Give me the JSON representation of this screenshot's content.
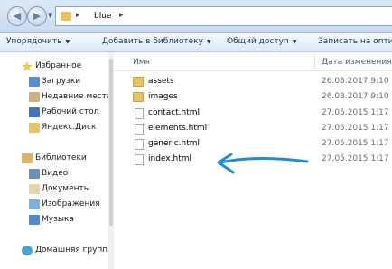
{
  "address": {
    "crumb": "blue",
    "sep": "▸"
  },
  "toolbar": {
    "organize": "Упорядочить",
    "add_library": "Добавить в библиотеку",
    "share": "Общий доступ",
    "burn": "Записать на оптич",
    "dropdown": "▼"
  },
  "nav": {
    "favorites": "Избранное",
    "downloads": "Загрузки",
    "recent": "Недавние места",
    "desktop": "Рабочий стол",
    "yadisk": "Яндекс.Диск",
    "libraries": "Библиотеки",
    "video": "Видео",
    "documents": "Документы",
    "images": "Изображения",
    "music": "Музыка",
    "homegroup": "Домашняя группа"
  },
  "columns": {
    "name": "Имя",
    "date": "Дата изменения"
  },
  "files": [
    {
      "name": "assets",
      "date": "26.03.2017 9:10",
      "kind": "folder"
    },
    {
      "name": "images",
      "date": "26.03.2017 9:10",
      "kind": "folder"
    },
    {
      "name": "contact.html",
      "date": "27.05.2015 1:17",
      "kind": "html"
    },
    {
      "name": "elements.html",
      "date": "27.05.2015 1:17",
      "kind": "html"
    },
    {
      "name": "generic.html",
      "date": "27.05.2015 1:17",
      "kind": "html"
    },
    {
      "name": "index.html",
      "date": "27.05.2015 1:17",
      "kind": "html"
    }
  ],
  "colors": {
    "annotation": "#1a8fd6",
    "folder": "#e6c461"
  }
}
